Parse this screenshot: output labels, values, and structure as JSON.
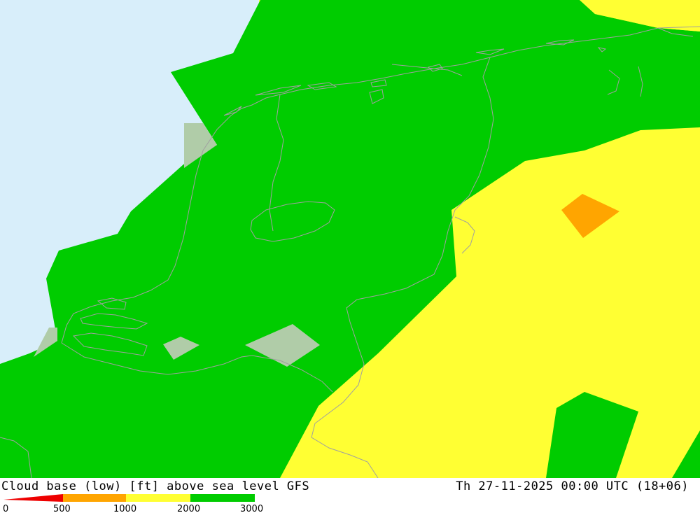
{
  "title": "Cloud base (low) [ft] above sea level GFS",
  "datetime": "Th 27-11-2025 00:00 UTC (18+06)",
  "legend": {
    "ticks": [
      "0",
      "500",
      "1000",
      "2000",
      "3000"
    ],
    "colors": [
      "#ee0000",
      "#ffa500",
      "#ffff33",
      "#00cc00"
    ]
  },
  "map_colors": {
    "sea": "#d8eefa",
    "band_0_500": "#ee0000",
    "band_500_1000": "#ffa500",
    "band_1000_2000": "#ffff33",
    "band_2000_3000": "#00cc00",
    "no_data_land": "#b0cca8",
    "border": "#a0a0a0"
  }
}
